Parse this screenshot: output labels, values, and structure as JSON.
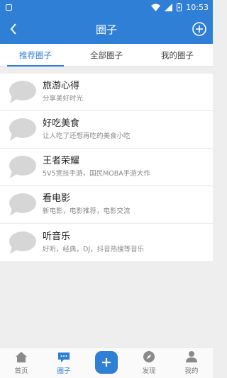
{
  "status": {
    "time": "10:53"
  },
  "header": {
    "title": "圈子"
  },
  "tabs": [
    {
      "label": "推荐圈子",
      "active": true
    },
    {
      "label": "全部圈子",
      "active": false
    },
    {
      "label": "我的圈子",
      "active": false
    }
  ],
  "circles": [
    {
      "title": "旅游心得",
      "desc": "分享美好时光"
    },
    {
      "title": "好吃美食",
      "desc": "让人吃了还想再吃的美食小吃"
    },
    {
      "title": "王者荣耀",
      "desc": "5V5竞技手游，国民MOBA手游大作"
    },
    {
      "title": "看电影",
      "desc": "新电影，电影推荐，电影交流"
    },
    {
      "title": "听音乐",
      "desc": "好听，经典，DJ，抖音热搜等音乐"
    }
  ],
  "bottom_nav": [
    {
      "label": "首页",
      "icon": "home-icon"
    },
    {
      "label": "圈子",
      "icon": "chat-icon",
      "active": true
    },
    {
      "label": "",
      "icon": "plus-icon"
    },
    {
      "label": "发现",
      "icon": "compass-icon"
    },
    {
      "label": "我的",
      "icon": "person-icon"
    }
  ],
  "colors": {
    "accent": "#2f7fd6",
    "avatar": "#d6d6d6"
  }
}
